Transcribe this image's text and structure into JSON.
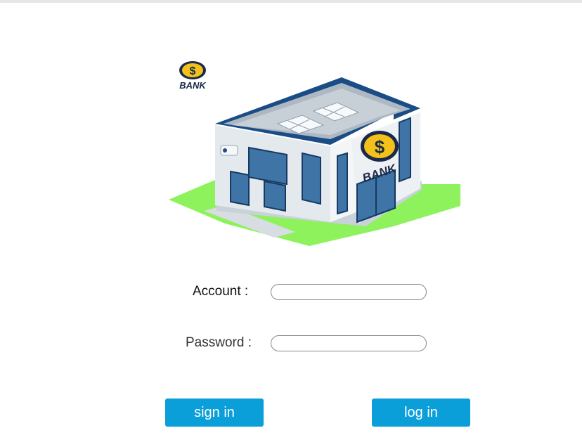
{
  "logo": {
    "text": "BANK"
  },
  "building": {
    "sign_text": "BANK"
  },
  "form": {
    "account_label": "Account :",
    "account_value": "",
    "password_label": "Password :",
    "password_value": ""
  },
  "buttons": {
    "sign_in_label": "sign in",
    "log_in_label": "log in"
  },
  "colors": {
    "button": "#0a9fd8",
    "grass": "#8ef25c",
    "roof_trim": "#1a4c86",
    "logo_gold": "#f2c21a",
    "logo_navy": "#1b2a4a"
  }
}
